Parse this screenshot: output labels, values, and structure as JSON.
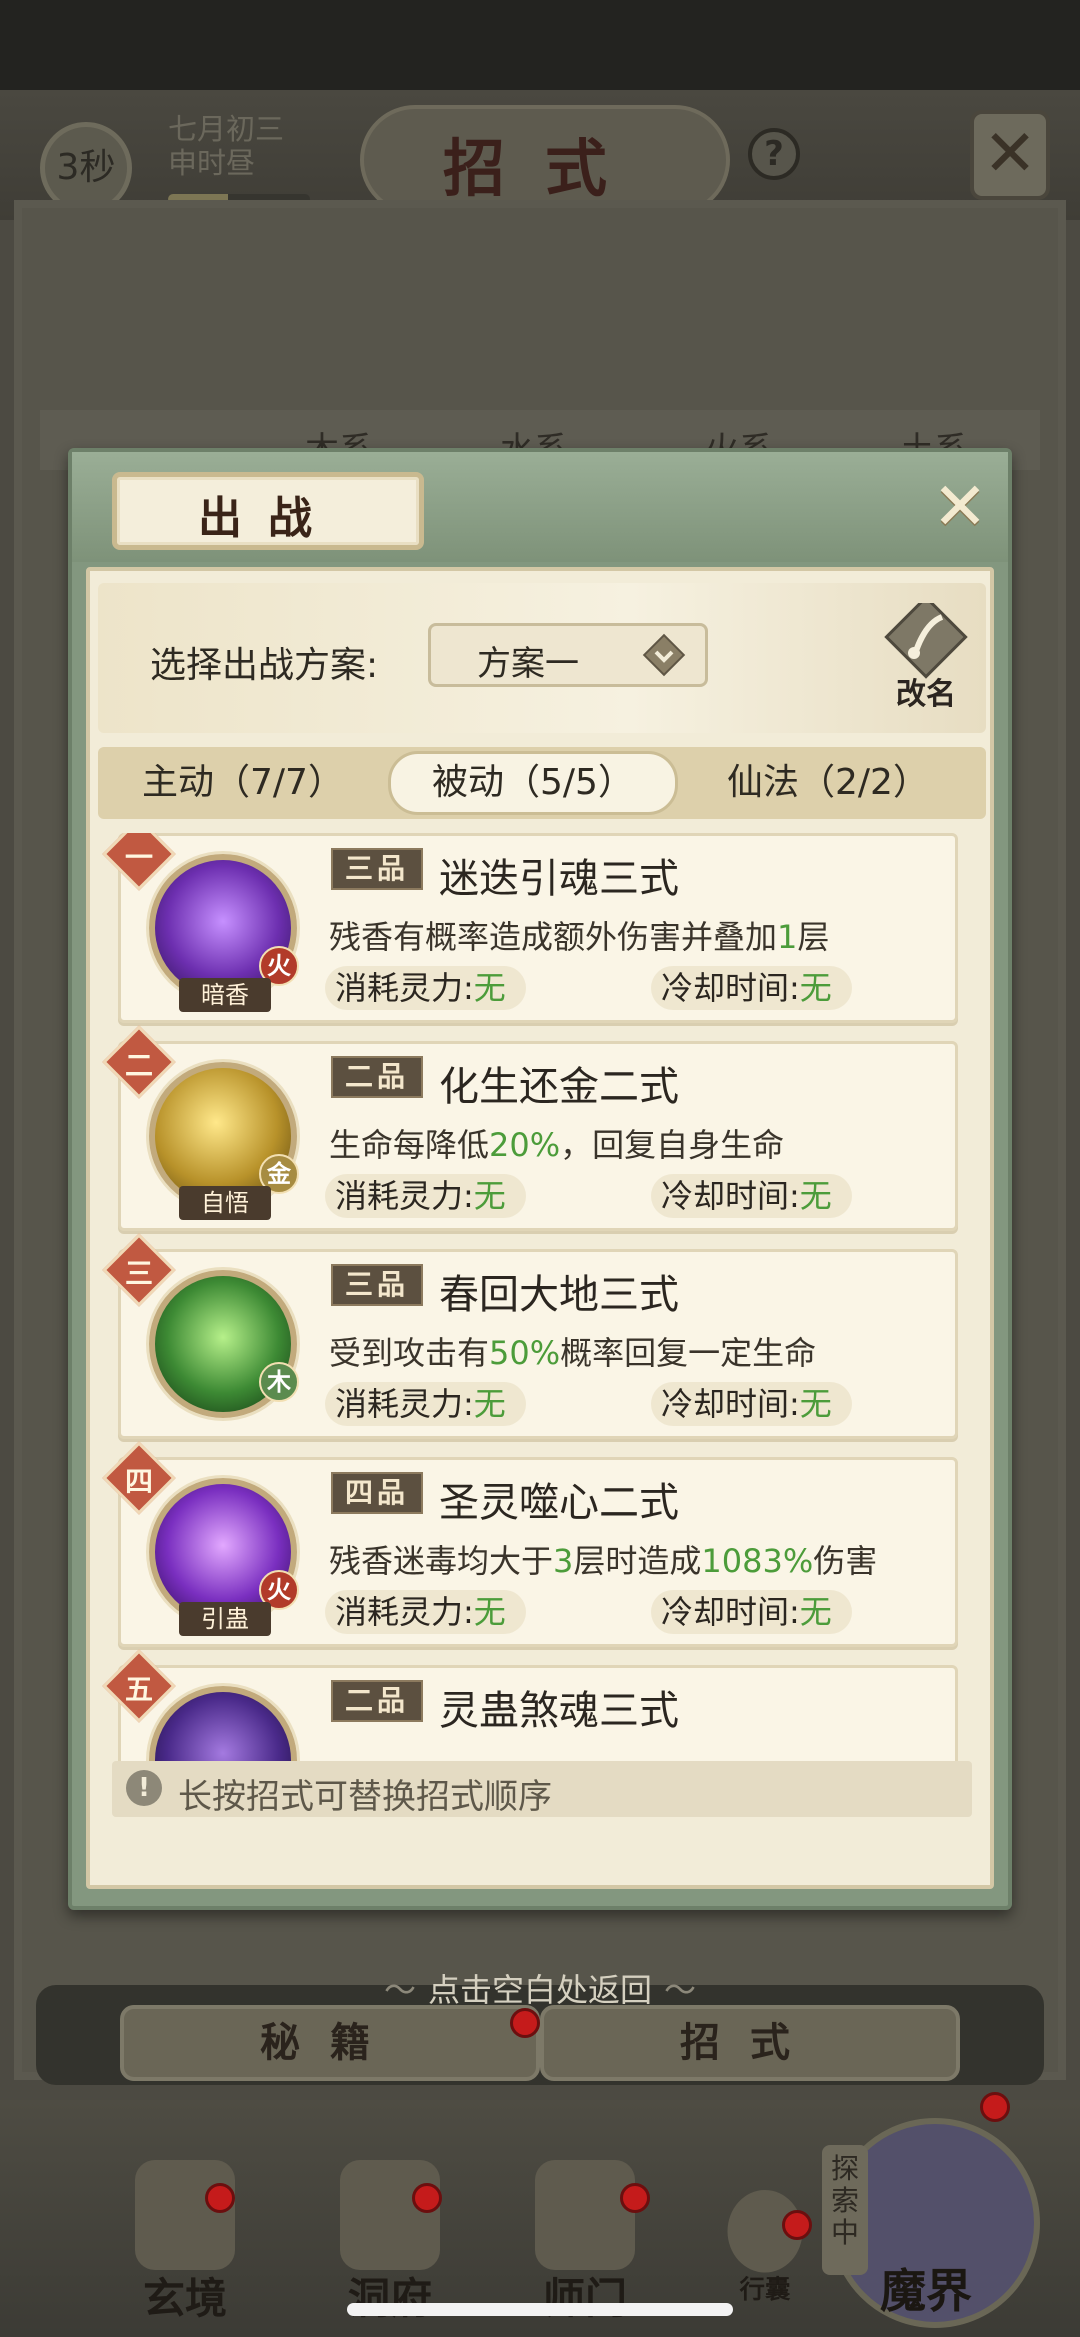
{
  "background": {
    "timer": "3秒",
    "date_line1": "七月初三",
    "date_line2": "申时昼",
    "date_progress": 0.42,
    "title": "招式",
    "help": "?",
    "tabs": [
      "木系",
      "水系",
      "火系",
      "土系"
    ],
    "return_hint": "点击空白处返回",
    "bottom_buttons": [
      "秘籍",
      "招式"
    ],
    "nav": [
      "玄境",
      "洞府",
      "师门",
      "行囊"
    ],
    "explore_tag": "探索中",
    "magic": "魔界"
  },
  "modal": {
    "title": "出战",
    "plan_label": "选择出战方案:",
    "plan_value": "方案一",
    "rename": "改名",
    "tabs": [
      {
        "label": "主动（7/7）",
        "active": false
      },
      {
        "label": "被动（5/5）",
        "active": true
      },
      {
        "label": "仙法（2/2）",
        "active": false
      }
    ],
    "cost_label": "消耗灵力:",
    "cooldown_label": "冷却时间:",
    "skills": [
      {
        "rank": "一",
        "grade": "三品",
        "name": "迷迭引魂三式",
        "desc_pre": "残香有概率造成额外伤害并叠加",
        "desc_hl": "1",
        "desc_post": "层",
        "element": "火",
        "tag": "暗香",
        "cost": "无",
        "cooldown": "无",
        "color": "#6d2fb0"
      },
      {
        "rank": "二",
        "grade": "二品",
        "name": "化生还金二式",
        "desc_pre": "生命每降低",
        "desc_hl": "20%",
        "desc_post": "，回复自身生命",
        "element": "金",
        "tag": "自悟",
        "cost": "无",
        "cooldown": "无",
        "color": "#b8922a"
      },
      {
        "rank": "三",
        "grade": "三品",
        "name": "春回大地三式",
        "desc_pre": "受到攻击有",
        "desc_hl": "50%",
        "desc_post": "概率回复一定生命",
        "element": "木",
        "tag": "",
        "cost": "无",
        "cooldown": "无",
        "color": "#3d8a34"
      },
      {
        "rank": "四",
        "grade": "四品",
        "name": "圣灵噬心二式",
        "desc_pre": "残香迷毒均大于",
        "desc_hl": "3",
        "desc_mid": "层时造成",
        "desc_hl2": "1083%",
        "desc_post": "伤害",
        "element": "火",
        "tag": "引蛊",
        "cost": "无",
        "cooldown": "无",
        "color": "#7a2fc0"
      },
      {
        "rank": "五",
        "grade": "二品",
        "name": "灵蛊煞魂三式",
        "element": "",
        "tag": "",
        "color": "#4a2a8a"
      }
    ],
    "tip": "长按招式可替换招式顺序"
  }
}
